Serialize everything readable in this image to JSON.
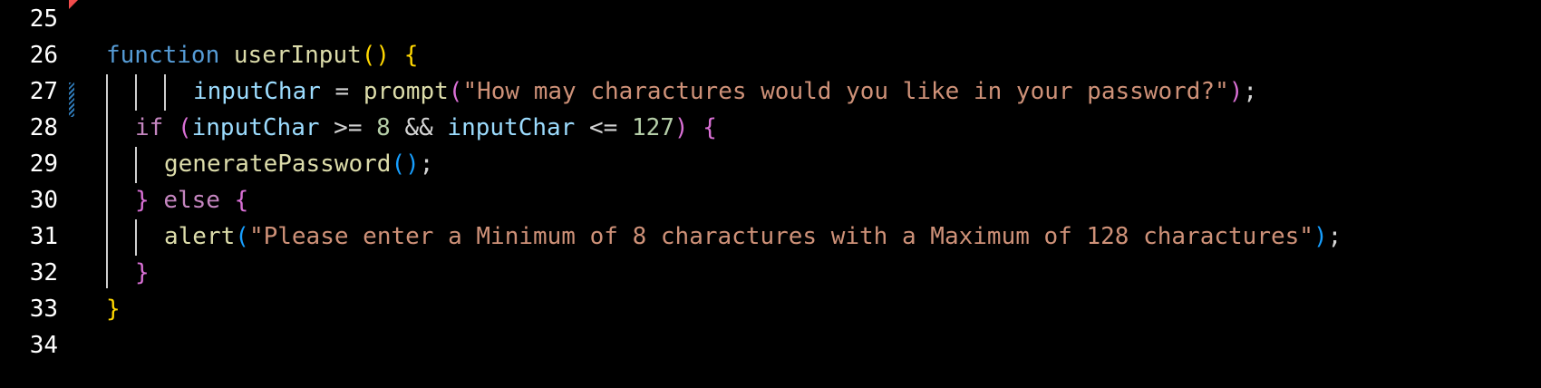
{
  "editor": {
    "lines": [
      {
        "number": "25"
      },
      {
        "number": "26",
        "kw": "function",
        "name": "userInput",
        "parens": "()",
        "brace": "{"
      },
      {
        "number": "27",
        "var": "inputChar",
        "eq": "=",
        "fn": "prompt",
        "lp": "(",
        "str": "\"How may charactures would you like in your password?\"",
        "rp": ")",
        "semi": ";"
      },
      {
        "number": "28",
        "kw": "if",
        "lp": "(",
        "var1": "inputChar",
        "op1": ">=",
        "num1": "8",
        "and": "&&",
        "var2": "inputChar",
        "op2": "<=",
        "num2": "127",
        "rp": ")",
        "brace": "{"
      },
      {
        "number": "29",
        "fn": "generatePassword",
        "parens": "()",
        "semi": ";"
      },
      {
        "number": "30",
        "close": "}",
        "kw": "else",
        "brace": "{"
      },
      {
        "number": "31",
        "fn": "alert",
        "lp": "(",
        "str": "\"Please enter a Minimum of 8 charactures with a Maximum of 128 charactures\"",
        "rp": ")",
        "semi": ";"
      },
      {
        "number": "32",
        "close": "}"
      },
      {
        "number": "33",
        "close": "}"
      },
      {
        "number": "34"
      }
    ]
  },
  "colors": {
    "background": "#000000",
    "line_number": "#ffffff",
    "keyword_function": "#569cd6",
    "function_name": "#dcdcaa",
    "string": "#ce9178",
    "variable": "#9cdcfe",
    "number": "#b5cea8",
    "control_keyword": "#c586c0",
    "bracket_level1": "#ffd700",
    "bracket_level2": "#da70d6",
    "bracket_level3": "#179fff"
  }
}
